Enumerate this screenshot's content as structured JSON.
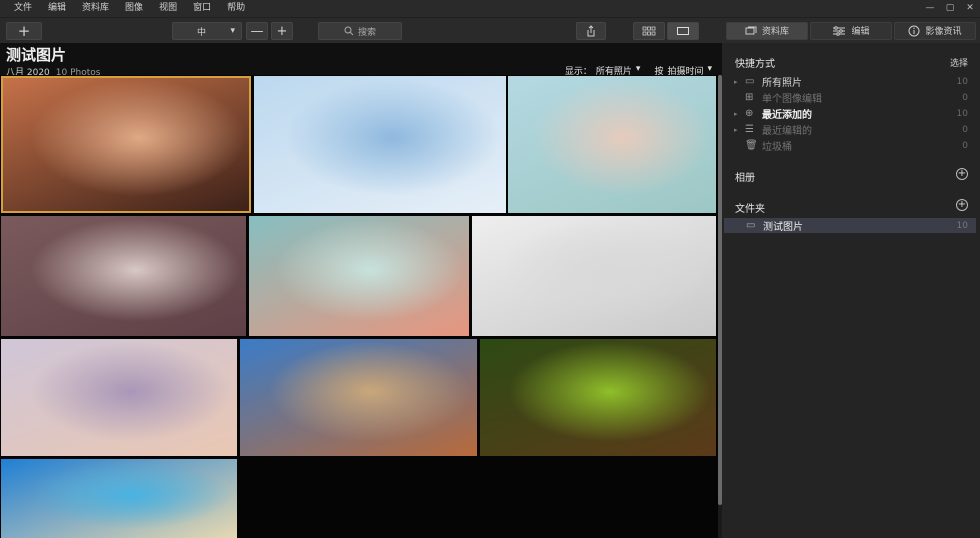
{
  "menu": [
    "文件",
    "编辑",
    "资料库",
    "图像",
    "视图",
    "窗口",
    "帮助"
  ],
  "window_controls": [
    "—",
    "▢",
    "✕"
  ],
  "toolbar": {
    "add_label": "+",
    "zoom_value": "中",
    "zoom_minus": "—",
    "zoom_plus": "+",
    "search_label": "搜索"
  },
  "panel_tabs": [
    {
      "label": "资料库",
      "active": true
    },
    {
      "label": "编辑",
      "active": false
    },
    {
      "label": "影像资讯",
      "active": false
    }
  ],
  "header": {
    "title": "测试图片",
    "date": "八月 2020",
    "count": "10 Photos",
    "show_label": "显示：",
    "show_value": "所有照片",
    "sort_label": "按",
    "sort_value": "拍摄时间"
  },
  "photos": [
    {
      "name": "photo-portrait-1",
      "colors": [
        "#c8734a",
        "#e0a985",
        "#3b2018"
      ],
      "selected": true
    },
    {
      "name": "photo-portrait-2",
      "colors": [
        "#bcd8ef",
        "#8fb9de",
        "#e6eff7"
      ],
      "selected": false
    },
    {
      "name": "photo-portrait-3",
      "colors": [
        "#b4d9e2",
        "#e6cbbd",
        "#9dc7c4"
      ],
      "selected": false
    },
    {
      "name": "photo-portrait-4",
      "colors": [
        "#7a5a5c",
        "#d8c8c4",
        "#5e4046"
      ],
      "selected": false
    },
    {
      "name": "photo-portrait-5",
      "colors": [
        "#86bfc1",
        "#c7e2dc",
        "#e7957e"
      ],
      "selected": false
    },
    {
      "name": "photo-portrait-6",
      "colors": [
        "#eeeeee",
        "#d9d9d9",
        "#c9c9c9"
      ],
      "selected": false
    },
    {
      "name": "photo-portrait-7",
      "colors": [
        "#cfc6d8",
        "#a897b8",
        "#e9c7b3"
      ],
      "selected": false
    },
    {
      "name": "photo-landscape-desert",
      "colors": [
        "#3a7cc8",
        "#c9a77a",
        "#b86a3a"
      ],
      "selected": false
    },
    {
      "name": "photo-landscape-forest",
      "colors": [
        "#2d4a14",
        "#8fbf2a",
        "#5c3a1a"
      ],
      "selected": false
    },
    {
      "name": "photo-landscape-beach",
      "colors": [
        "#1f7fd4",
        "#49b2e0",
        "#e8d9b0"
      ],
      "selected": false
    }
  ],
  "sidebar": {
    "shortcuts_title": "快捷方式",
    "select_label": "选择",
    "items": [
      {
        "label": "所有照片",
        "count": "10",
        "icon": "photos-icon",
        "style": "bright",
        "arrow": "▸"
      },
      {
        "label": "单个图像编辑",
        "count": "0",
        "icon": "grid-icon",
        "style": "dim",
        "arrow": ""
      },
      {
        "label": "最近添加的",
        "count": "10",
        "icon": "plus-circle-icon",
        "style": "bright",
        "arrow": "▸"
      },
      {
        "label": "最近编辑的",
        "count": "0",
        "icon": "sliders-icon",
        "style": "dim",
        "arrow": "▸"
      },
      {
        "label": "垃圾桶",
        "count": "0",
        "icon": "trash-icon",
        "style": "dim",
        "arrow": ""
      }
    ],
    "albums_title": "相册",
    "folders_title": "文件夹",
    "folder": {
      "label": "测试图片",
      "count": "10"
    }
  }
}
